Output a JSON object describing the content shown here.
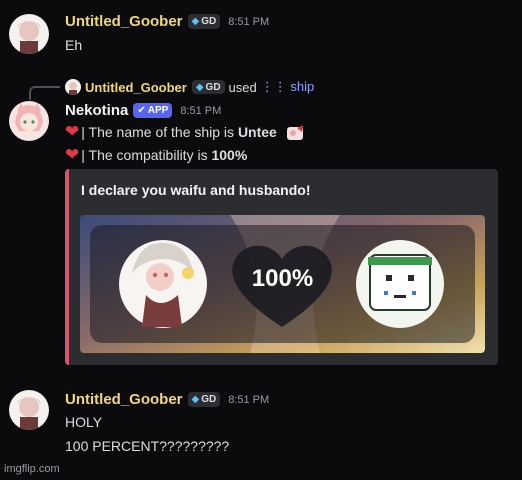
{
  "messages": [
    {
      "username": "Untitled_Goober",
      "tag": "GD",
      "time": "8:51 PM",
      "lines": [
        "Eh"
      ]
    },
    {
      "reply": {
        "username": "Untitled_Goober",
        "tag": "GD",
        "used": "used",
        "command": "ship"
      },
      "username": "Nekotina",
      "app_badge": "APP",
      "time": "8:51 PM",
      "line1": {
        "text": "| The name of the ship is ",
        "bold": "Untee"
      },
      "line2": {
        "text": "| The compatibility is ",
        "bold": "100%"
      },
      "embed": {
        "title": "I declare you waifu and husbando!",
        "percent": "100%",
        "accent_color": "#d9566a"
      }
    },
    {
      "username": "Untitled_Goober",
      "tag": "GD",
      "time": "8:51 PM",
      "lines": [
        "HOLY",
        "100 PERCENT?????????"
      ]
    }
  ],
  "icons": {
    "heart": "red-heart",
    "gem": "diamond",
    "command": "slash-command"
  },
  "colors": {
    "background": "#0b0b0d",
    "username": "#f0d87a",
    "app_badge": "#5865f2",
    "heart": "#e03a4a"
  },
  "watermark": "imgflip.com"
}
